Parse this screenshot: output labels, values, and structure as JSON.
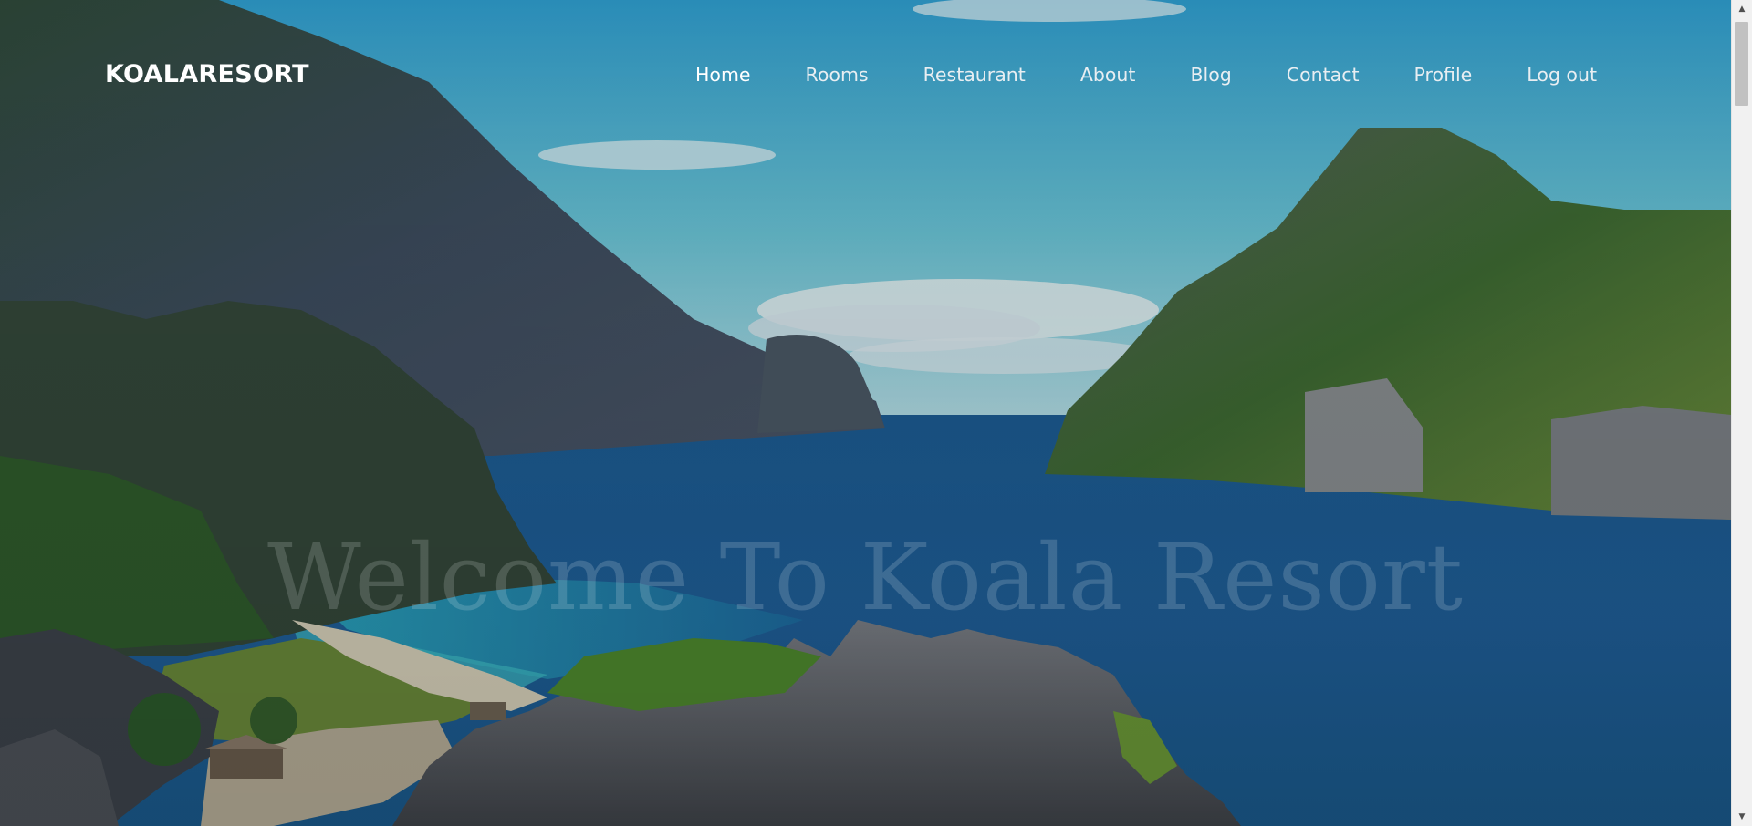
{
  "brand": "KOALARESORT",
  "nav": {
    "items": [
      {
        "label": "Home",
        "active": true
      },
      {
        "label": "Rooms",
        "active": false
      },
      {
        "label": "Restaurant",
        "active": false
      },
      {
        "label": "About",
        "active": false
      },
      {
        "label": "Blog",
        "active": false
      },
      {
        "label": "Contact",
        "active": false
      },
      {
        "label": "Profile",
        "active": false
      },
      {
        "label": "Log out",
        "active": false
      }
    ]
  },
  "hero": {
    "title": "Welcome To Koala Resort"
  },
  "colors": {
    "nav_text": "#e8eef2",
    "brand_text": "#ffffff",
    "sea": "#1e5f96",
    "sky": "#5fbcd8"
  },
  "icons": {
    "scroll_up": "triangle-up-icon",
    "scroll_down": "triangle-down-icon"
  }
}
